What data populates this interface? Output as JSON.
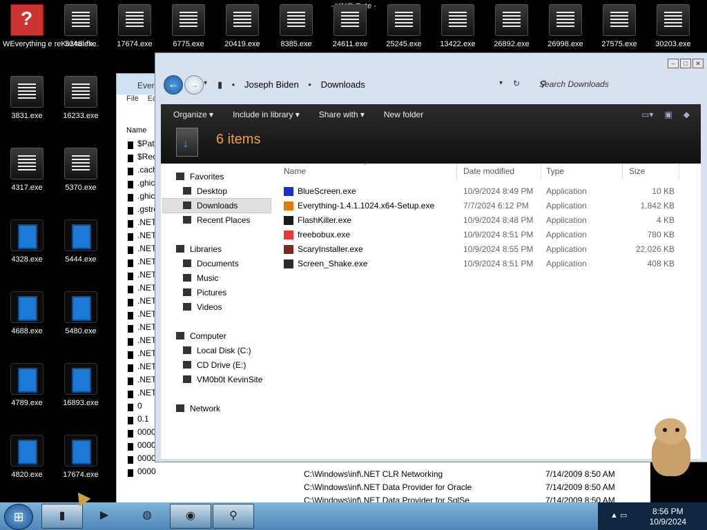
{
  "desktop": {
    "title": "- VAIO Gate -",
    "icons": [
      {
        "label": "WEverything e reKeMail.fb...",
        "kind": "everything"
      },
      {
        "label": "5348.exe",
        "kind": "app"
      },
      {
        "label": "17674.exe",
        "kind": "app"
      },
      {
        "label": "6775.exe",
        "kind": "app"
      },
      {
        "label": "20419.exe",
        "kind": "app"
      },
      {
        "label": "8385.exe",
        "kind": "app"
      },
      {
        "label": "24611.exe",
        "kind": "app"
      },
      {
        "label": "25245.exe",
        "kind": "app"
      },
      {
        "label": "13422.exe",
        "kind": "app"
      },
      {
        "label": "26892.exe",
        "kind": "app"
      },
      {
        "label": "26998.exe",
        "kind": "app"
      },
      {
        "label": "27575.exe",
        "kind": "app"
      },
      {
        "label": "30203.exe",
        "kind": "app"
      },
      {
        "label": "3831.exe",
        "kind": "app"
      },
      {
        "label": "16233.exe",
        "kind": "app"
      },
      {
        "label": "4317.exe",
        "kind": "app"
      },
      {
        "label": "5370.exe",
        "kind": "app"
      },
      {
        "label": "4328.exe",
        "kind": "blue"
      },
      {
        "label": "5444.exe",
        "kind": "blue"
      },
      {
        "label": "4688.exe",
        "kind": "blue"
      },
      {
        "label": "5480.exe",
        "kind": "blue"
      },
      {
        "label": "4789.exe",
        "kind": "blue"
      },
      {
        "label": "16893.exe",
        "kind": "blue"
      },
      {
        "label": "4820.exe",
        "kind": "blue"
      },
      {
        "label": "17674.exe",
        "kind": "blue"
      }
    ]
  },
  "bg_window": {
    "title": "Every",
    "menu": [
      "File",
      "Ed"
    ],
    "column": "Name",
    "rows": [
      "$Patc",
      "$Recy",
      ".cach",
      ".ghic",
      ".ghic",
      ".gstre",
      ".NET",
      ".NET",
      ".NET",
      ".NET",
      ".NET",
      ".NET",
      ".NET",
      ".NET",
      ".NET",
      ".NET",
      ".NET",
      ".NET",
      ".NET",
      ".NET",
      "0",
      "0.1",
      "0000",
      "0000",
      "0000",
      "0000"
    ],
    "strip_rows": [
      {
        "path": "C:\\Windows\\inf\\.NET CLR Networking",
        "date": "7/14/2009 8:50 AM"
      },
      {
        "path": "C:\\Windows\\inf\\.NET Data Provider for Oracle",
        "date": "7/14/2009 8:50 AM"
      },
      {
        "path": "C:\\Windows\\inf\\.NET Data Provider for SqlSe",
        "date": "7/14/2009 8:50 AM"
      }
    ]
  },
  "explorer": {
    "breadcrumb": [
      "Joseph Biden",
      "Downloads"
    ],
    "search_placeholder": "Search Downloads",
    "commands": [
      "Organize ▾",
      "Include in library ▾",
      "Share with ▾",
      "New folder"
    ],
    "item_count": "6 items",
    "nav": {
      "favorites": "Favorites",
      "desktop": "Desktop",
      "downloads": "Downloads",
      "recent": "Recent Places",
      "libraries": "Libraries",
      "documents": "Documents",
      "music": "Music",
      "pictures": "Pictures",
      "videos": "Videos",
      "computer": "Computer",
      "local_disk": "Local Disk (C:)",
      "cd_drive": "CD Drive (E:)",
      "netshare": "VM0b0t KevinSite",
      "network": "Network"
    },
    "columns": {
      "name": "Name",
      "date": "Date modified",
      "type": "Type",
      "size": "Size"
    },
    "files": [
      {
        "name": "BlueScreen.exe",
        "date": "10/9/2024 8:49 PM",
        "type": "Application",
        "size": "10 KB",
        "icon_color": "#1b2fd0"
      },
      {
        "name": "Everything-1.4.1.1024.x64-Setup.exe",
        "date": "7/7/2024 6:12 PM",
        "type": "Application",
        "size": "1,842 KB",
        "icon_color": "#e07b00"
      },
      {
        "name": "FlashKiller.exe",
        "date": "10/9/2024 8:48 PM",
        "type": "Application",
        "size": "4 KB",
        "icon_color": "#1a1a1a"
      },
      {
        "name": "freebobux.exe",
        "date": "10/9/2024 8:51 PM",
        "type": "Application",
        "size": "780 KB",
        "icon_color": "#e53935"
      },
      {
        "name": "ScaryInstaller.exe",
        "date": "10/9/2024 8:55 PM",
        "type": "Application",
        "size": "22,026 KB",
        "icon_color": "#7a2a1a"
      },
      {
        "name": "Screen_Shake.exe",
        "date": "10/9/2024 8:51 PM",
        "type": "Application",
        "size": "408 KB",
        "icon_color": "#2a2a2a"
      }
    ]
  },
  "taskbar": {
    "time": "8:56 PM",
    "date": "10/9/2024"
  }
}
